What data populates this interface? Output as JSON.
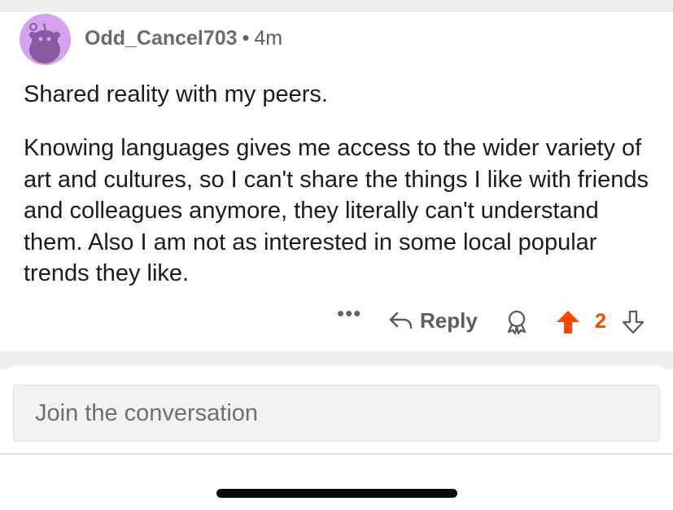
{
  "comment": {
    "author": "Odd_Cancel703",
    "separator": "•",
    "age": "4m",
    "paragraphs": [
      "Shared reality with my peers.",
      "Knowing languages gives me access to the wider variety of art and cultures, so I can't share the things I like with friends and colleagues anymore, they literally can't understand them. Also I am not as interested in some local popular trends they like."
    ],
    "actions": {
      "more": "•••",
      "reply_label": "Reply",
      "vote_count": "2"
    },
    "icons": {
      "avatar": "snoo-avatar-icon",
      "reply": "reply-arrow-icon",
      "award": "award-icon",
      "upvote": "upvote-arrow-icon",
      "downvote": "downvote-arrow-icon"
    }
  },
  "composer": {
    "placeholder": "Join the conversation"
  },
  "colors": {
    "upvote_active": "#ff4500",
    "avatar_bg": "#d8a0f0",
    "text": "#1c1c1c",
    "meta": "#5c5c5c"
  }
}
